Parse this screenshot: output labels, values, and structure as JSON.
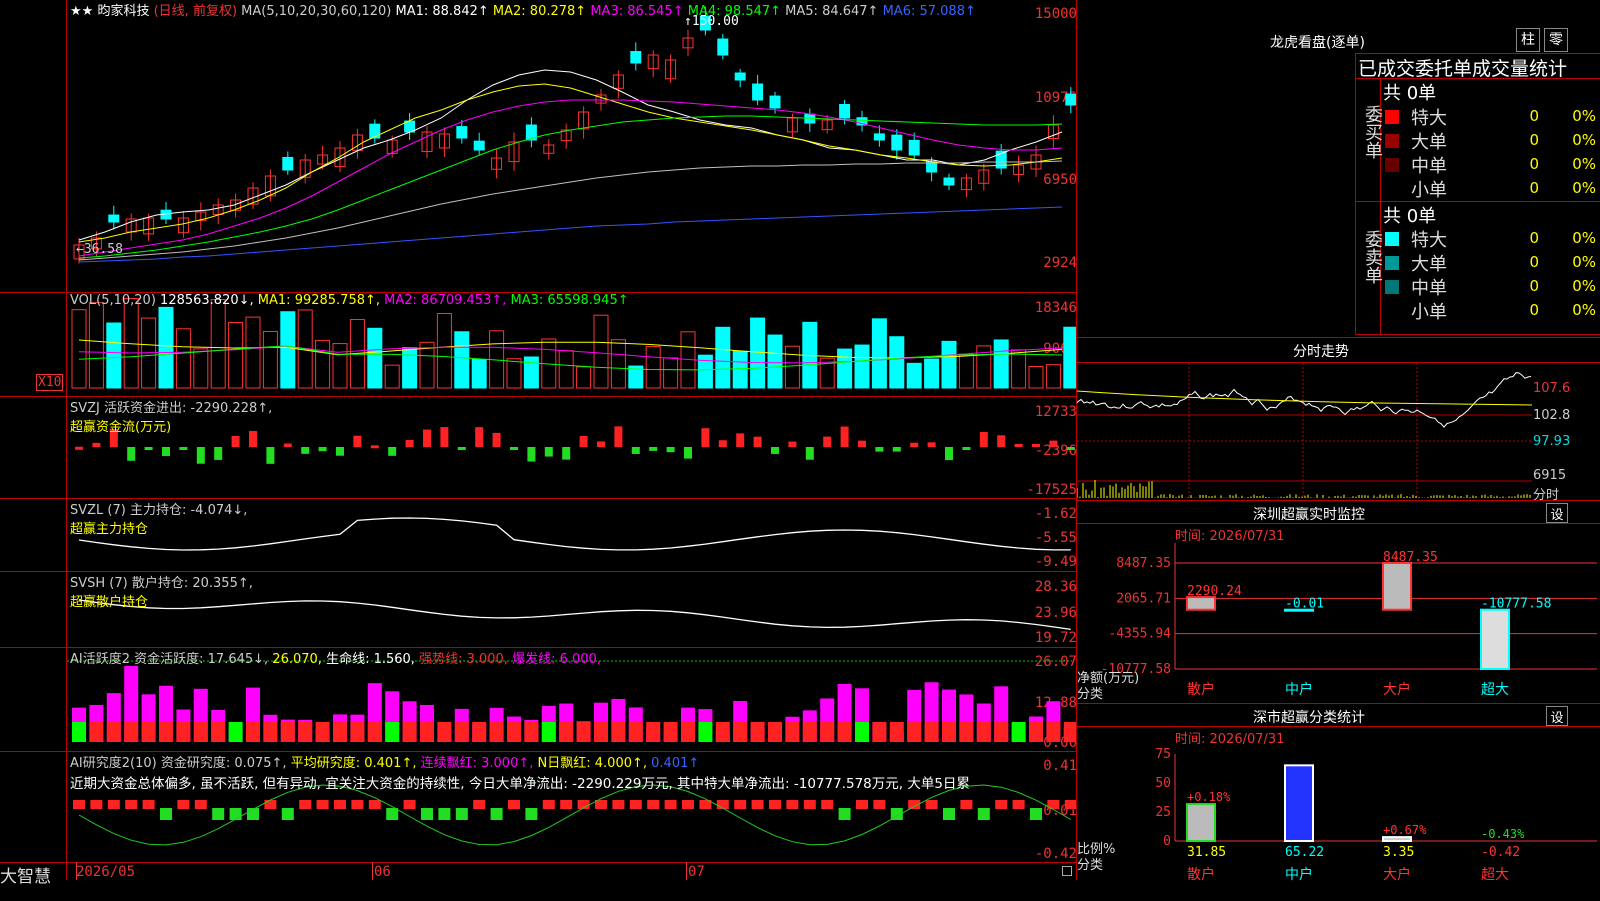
{
  "title_bar": {
    "marks": "★★",
    "stock_name": "昀家科技",
    "mode": "(日线, 前复权)",
    "ma_params": "MA(5,10,20,30,60,120)"
  },
  "ma_values": [
    {
      "label": "MA1: 88.842↑",
      "color": "#ffffff"
    },
    {
      "label": "MA2: 80.278↑",
      "color": "#ffff00"
    },
    {
      "label": "MA3: 86.545↑",
      "color": "#ff00ff"
    },
    {
      "label": "MA4: 98.547↑",
      "color": "#00ff00"
    },
    {
      "label": "MA5: 84.647↑",
      "color": "#c0c0c0"
    },
    {
      "label": "MA6: 57.088↑",
      "color": "#3355ff"
    }
  ],
  "price_axis": [
    "15000",
    "10975",
    "6950",
    "2924"
  ],
  "annotations": {
    "high": "150.00",
    "low": "36.58"
  },
  "vol": {
    "title": "VOL(5,10,20)",
    "value": "128563.820↓,",
    "ma1": "MA1: 99285.758↑,",
    "ma2": "MA2: 86709.453↑,",
    "ma3": "MA3: 65598.945↑",
    "axis": [
      "18346",
      "9060"
    ],
    "unit": "X10"
  },
  "svzj": {
    "title": "SVZJ  活跃资金进出: -2290.228↑,",
    "subtitle": "超赢资金流(万元)",
    "axis": [
      "12733",
      "-2396",
      "-17525"
    ]
  },
  "svzl": {
    "title": "SVZL (7) 主力持仓: -4.074↓,",
    "subtitle": "超赢主力持仓",
    "axis": [
      "-1.62",
      "-5.55",
      "-9.49"
    ]
  },
  "svsh": {
    "title": "SVSH (7) 散户持仓: 20.355↑,",
    "subtitle": "超赢散户持仓",
    "axis": [
      "28.36",
      "23.96",
      "19.72"
    ]
  },
  "ai_act": {
    "title": "AI活跃度2 资金活跃度: 17.645↓,",
    "v2": "26.070,",
    "v3": "生命线: 1.560,",
    "v4": "强势线: 3.000,",
    "v5": "爆发线: 6.000,",
    "axis": [
      "26.07",
      "12.88",
      "0.00"
    ]
  },
  "ai_res": {
    "title": "AI研究度2(10) 资金研究度: 0.075↑,",
    "v2": "平均研究度: 0.401↑,",
    "v3": "连续飘红: 3.000↑,",
    "v4": "N日飘红: 4.000↑,",
    "v5": "0.401↑",
    "note": "近期大资金总体偏多, 虽不活跃, 但有异动, 宜关注大资金的持续性, 今日大单净流出: -2290.229万元, 其中特大单净流出: -10777.578万元, 大单5日累",
    "axis": [
      "0.41",
      "-0.01",
      "-0.42"
    ]
  },
  "date_axis": [
    "2026/05",
    "06",
    "07"
  ],
  "app_name": "大智慧",
  "lhb": {
    "title": "龙虎看盘(逐单)",
    "btn1": "柱",
    "btn2": "零",
    "header": "已成交委托单成交量统计",
    "buy": {
      "label": "委买单",
      "total": "共 0单",
      "rows": [
        {
          "name": "特大",
          "v": "0",
          "p": "0%",
          "c": "#ff0000"
        },
        {
          "name": "大单",
          "v": "0",
          "p": "0%",
          "c": "#990000"
        },
        {
          "name": "中单",
          "v": "0",
          "p": "0%",
          "c": "#660000"
        },
        {
          "name": "小单",
          "v": "0",
          "p": "0%",
          "c": "#000000"
        }
      ]
    },
    "sell": {
      "label": "委卖单",
      "total": "共 0单",
      "rows": [
        {
          "name": "特大",
          "v": "0",
          "p": "0%",
          "c": "#00ffff"
        },
        {
          "name": "大单",
          "v": "0",
          "p": "0%",
          "c": "#009999"
        },
        {
          "name": "中单",
          "v": "0",
          "p": "0%",
          "c": "#007777"
        },
        {
          "name": "小单",
          "v": "0",
          "p": "0%",
          "c": "#000000"
        }
      ]
    }
  },
  "intraday": {
    "title": "分时走势",
    "axis": [
      "107.6",
      "102.8",
      "97.93",
      "6915"
    ],
    "unit": "分时"
  },
  "sz_monitor": {
    "title": "深圳超赢实时监控",
    "btn": "设",
    "time": "时间: 2026/07/31",
    "ylabel": "净额(万元)",
    "xlabel": "分类"
  },
  "sz_stats": {
    "title": "深市超赢分类统计",
    "btn": "设",
    "time": "时间: 2026/07/31",
    "ylabel": "比例%",
    "xlabel": "分类"
  },
  "chart_data": [
    {
      "type": "bar",
      "title": "深圳超赢实时监控",
      "categories": [
        "散户",
        "中户",
        "大户",
        "超大"
      ],
      "values": [
        2290.24,
        -0.01,
        8487.35,
        -10777.58
      ],
      "value_labels": [
        "2290.24",
        "-0.01",
        "8487.35",
        "-10777.58"
      ],
      "ylabel": "净额(万元)",
      "xlabel": "分类",
      "y_ticks": [
        "8487.35",
        "2065.71",
        "-4355.94",
        "-10777.58"
      ],
      "ylim": [
        -10777.58,
        8487.35
      ]
    },
    {
      "type": "bar",
      "title": "深市超赢分类统计",
      "categories": [
        "散户",
        "中户",
        "大户",
        "超大"
      ],
      "values": [
        31.85,
        65.22,
        3.35,
        -0.42
      ],
      "value_labels": [
        "31.85",
        "65.22",
        "3.35",
        "-0.42"
      ],
      "change_labels": [
        "+0.18%",
        "",
        "+0.67%",
        "-0.43%"
      ],
      "ylabel": "比例%",
      "xlabel": "分类",
      "y_ticks": [
        "75",
        "50",
        "25",
        "0"
      ],
      "ylim": [
        0,
        75
      ]
    }
  ]
}
